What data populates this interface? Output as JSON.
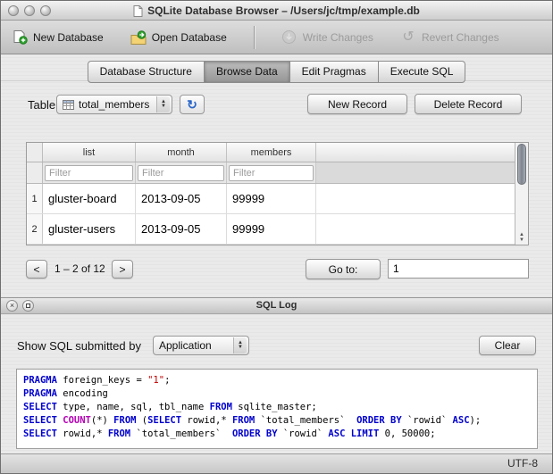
{
  "window": {
    "title": "SQLite Database Browser – /Users/jc/tmp/example.db",
    "encoding": "UTF-8"
  },
  "toolbar": {
    "items": [
      {
        "label": "New Database",
        "enabled": true
      },
      {
        "label": "Open Database",
        "enabled": true
      },
      {
        "label": "Write Changes",
        "enabled": false
      },
      {
        "label": "Revert Changes",
        "enabled": false
      }
    ]
  },
  "tabs": {
    "items": [
      "Database Structure",
      "Browse Data",
      "Edit Pragmas",
      "Execute SQL"
    ],
    "active": "Browse Data"
  },
  "browse": {
    "table_label": "Table:",
    "table_value": "total_members",
    "new_record_label": "New Record",
    "delete_record_label": "Delete Record",
    "columns": [
      "list",
      "month",
      "members"
    ],
    "filter_placeholder": "Filter",
    "rows": [
      {
        "num": "1",
        "list": "gluster-board",
        "month": "2013-09-05",
        "members": "99999"
      },
      {
        "num": "2",
        "list": "gluster-users",
        "month": "2013-09-05",
        "members": "99999"
      }
    ],
    "pagination": {
      "prev_label": "<",
      "range_label": "1 – 2 of 12",
      "next_label": ">",
      "goto_label": "Go to:",
      "goto_value": "1"
    }
  },
  "sql_log": {
    "title": "SQL Log",
    "show_label": "Show SQL submitted by",
    "source_value": "Application",
    "clear_label": "Clear",
    "colors": {
      "keyword": "#0000cc",
      "function": "#b400b4",
      "string": "#c00000",
      "plain": "#000000"
    },
    "lines": [
      [
        {
          "c": "keyword",
          "t": "PRAGMA"
        },
        {
          "c": "plain",
          "t": " foreign_keys = "
        },
        {
          "c": "string",
          "t": "\"1\""
        },
        {
          "c": "plain",
          "t": ";"
        }
      ],
      [
        {
          "c": "keyword",
          "t": "PRAGMA"
        },
        {
          "c": "plain",
          "t": " encoding"
        }
      ],
      [
        {
          "c": "keyword",
          "t": "SELECT"
        },
        {
          "c": "plain",
          "t": " type, name, sql, tbl_name "
        },
        {
          "c": "keyword",
          "t": "FROM"
        },
        {
          "c": "plain",
          "t": " sqlite_master;"
        }
      ],
      [
        {
          "c": "keyword",
          "t": "SELECT"
        },
        {
          "c": "plain",
          "t": " "
        },
        {
          "c": "function",
          "t": "COUNT"
        },
        {
          "c": "plain",
          "t": "(*) "
        },
        {
          "c": "keyword",
          "t": "FROM"
        },
        {
          "c": "plain",
          "t": " ("
        },
        {
          "c": "keyword",
          "t": "SELECT"
        },
        {
          "c": "plain",
          "t": " rowid,* "
        },
        {
          "c": "keyword",
          "t": "FROM"
        },
        {
          "c": "plain",
          "t": " `total_members`  "
        },
        {
          "c": "keyword",
          "t": "ORDER BY"
        },
        {
          "c": "plain",
          "t": " `rowid` "
        },
        {
          "c": "keyword",
          "t": "ASC"
        },
        {
          "c": "plain",
          "t": ");"
        }
      ],
      [
        {
          "c": "keyword",
          "t": "SELECT"
        },
        {
          "c": "plain",
          "t": " rowid,* "
        },
        {
          "c": "keyword",
          "t": "FROM"
        },
        {
          "c": "plain",
          "t": " `total_members`  "
        },
        {
          "c": "keyword",
          "t": "ORDER BY"
        },
        {
          "c": "plain",
          "t": " `rowid` "
        },
        {
          "c": "keyword",
          "t": "ASC"
        },
        {
          "c": "plain",
          "t": " "
        },
        {
          "c": "keyword",
          "t": "LIMIT"
        },
        {
          "c": "plain",
          "t": " 0, 50000;"
        }
      ]
    ]
  }
}
